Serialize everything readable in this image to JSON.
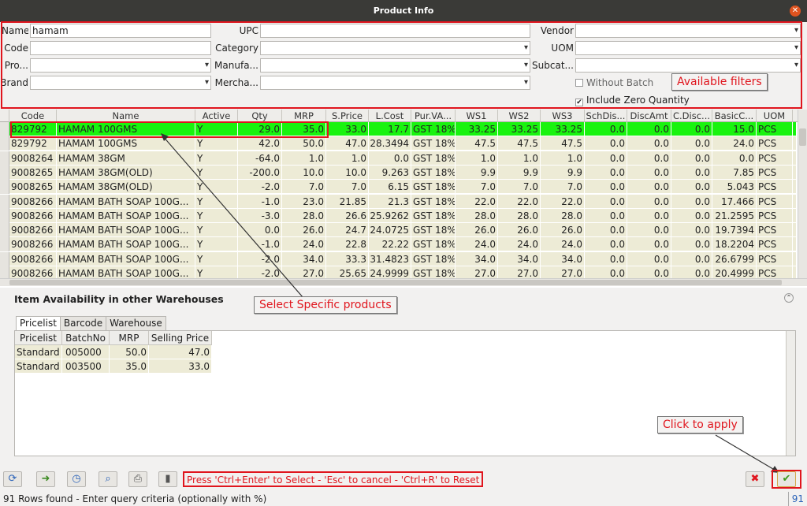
{
  "window": {
    "title": "Product Info",
    "close_icon": "close-icon"
  },
  "filters": {
    "name_label": "Name",
    "name_value": "hamam",
    "code_label": "Code",
    "code_value": "",
    "pro_label": "Pro...",
    "brand_label": "Brand",
    "upc_label": "UPC",
    "category_label": "Category",
    "manufa_label": "Manufa...",
    "mercha_label": "Mercha...",
    "vendor_label": "Vendor",
    "uom_label": "UOM",
    "subcat_label": "Subcat...",
    "without_batch": "Without Batch",
    "include_zero": "Include Zero Quantity",
    "include_zero_checked": true,
    "without_batch_checked": false
  },
  "annotations": {
    "available_filters": "Available filters",
    "select_products": "Select Specific products",
    "click_to_apply": "Click to apply"
  },
  "grid": {
    "columns": [
      "Code",
      "Name",
      "Active",
      "Qty",
      "MRP",
      "S.Price",
      "L.Cost",
      "Pur.VA...",
      "WS1",
      "WS2",
      "WS3",
      "SchDis...",
      "DiscAmt",
      "C.Disc...",
      "BasicC...",
      "UOM"
    ],
    "rows": [
      [
        "829792",
        "HAMAM 100GMS",
        "Y",
        "29.0",
        "35.0",
        "33.0",
        "17.7",
        "GST 18%",
        "33.25",
        "33.25",
        "33.25",
        "0.0",
        "0.0",
        "0.0",
        "15.0",
        "PCS"
      ],
      [
        "829792",
        "HAMAM 100GMS",
        "Y",
        "42.0",
        "50.0",
        "47.0",
        "28.3494",
        "GST 18%",
        "47.5",
        "47.5",
        "47.5",
        "0.0",
        "0.0",
        "0.0",
        "24.0",
        "PCS"
      ],
      [
        "9008264",
        "HAMAM 38GM",
        "Y",
        "-64.0",
        "1.0",
        "1.0",
        "0.0",
        "GST 18%",
        "1.0",
        "1.0",
        "1.0",
        "0.0",
        "0.0",
        "0.0",
        "0.0",
        "PCS"
      ],
      [
        "9008265",
        "HAMAM 38GM(OLD)",
        "Y",
        "-200.0",
        "10.0",
        "10.0",
        "9.263",
        "GST 18%",
        "9.9",
        "9.9",
        "9.9",
        "0.0",
        "0.0",
        "0.0",
        "7.85",
        "PCS"
      ],
      [
        "9008265",
        "HAMAM 38GM(OLD)",
        "Y",
        "-2.0",
        "7.0",
        "7.0",
        "6.15",
        "GST 18%",
        "7.0",
        "7.0",
        "7.0",
        "0.0",
        "0.0",
        "0.0",
        "5.043",
        "PCS"
      ],
      [
        "9008266",
        "HAMAM BATH SOAP 100G...",
        "Y",
        "-1.0",
        "23.0",
        "21.85",
        "21.3",
        "GST 18%",
        "22.0",
        "22.0",
        "22.0",
        "0.0",
        "0.0",
        "0.0",
        "17.466",
        "PCS"
      ],
      [
        "9008266",
        "HAMAM BATH SOAP 100G...",
        "Y",
        "-3.0",
        "28.0",
        "26.6",
        "25.9262",
        "GST 18%",
        "28.0",
        "28.0",
        "28.0",
        "0.0",
        "0.0",
        "0.0",
        "21.2595",
        "PCS"
      ],
      [
        "9008266",
        "HAMAM BATH SOAP 100G...",
        "Y",
        "0.0",
        "26.0",
        "24.7",
        "24.0725",
        "GST 18%",
        "26.0",
        "26.0",
        "26.0",
        "0.0",
        "0.0",
        "0.0",
        "19.7394",
        "PCS"
      ],
      [
        "9008266",
        "HAMAM BATH SOAP 100G...",
        "Y",
        "-1.0",
        "24.0",
        "22.8",
        "22.22",
        "GST 18%",
        "24.0",
        "24.0",
        "24.0",
        "0.0",
        "0.0",
        "0.0",
        "18.2204",
        "PCS"
      ],
      [
        "9008266",
        "HAMAM BATH SOAP 100G...",
        "Y",
        "-2.0",
        "34.0",
        "33.3",
        "31.4823",
        "GST 18%",
        "34.0",
        "34.0",
        "34.0",
        "0.0",
        "0.0",
        "0.0",
        "26.6799",
        "PCS"
      ],
      [
        "9008266",
        "HAMAM BATH SOAP 100G...",
        "Y",
        "-2.0",
        "27.0",
        "25.65",
        "24.9999",
        "GST 18%",
        "27.0",
        "27.0",
        "27.0",
        "0.0",
        "0.0",
        "0.0",
        "20.4999",
        "PCS"
      ]
    ]
  },
  "warehouse": {
    "title": "Item Availability in other Warehouses",
    "tabs": [
      "Pricelist",
      "Barcode",
      "Warehouse"
    ],
    "columns": [
      "Pricelist",
      "BatchNo",
      "MRP",
      "Selling Price"
    ],
    "rows": [
      [
        "Standard",
        "005000",
        "50.0",
        "47.0"
      ],
      [
        "Standard",
        "003500",
        "35.0",
        "33.0"
      ]
    ]
  },
  "footer": {
    "hint": "Press 'Ctrl+Enter' to Select - 'Esc' to cancel - 'Ctrl+R' to Reset",
    "status": "91 Rows found - Enter query criteria (optionally with %)",
    "count": "91"
  },
  "colors": {
    "selected_row": "#19f30f",
    "row": "#edebd6",
    "annotation": "#e0151d"
  }
}
